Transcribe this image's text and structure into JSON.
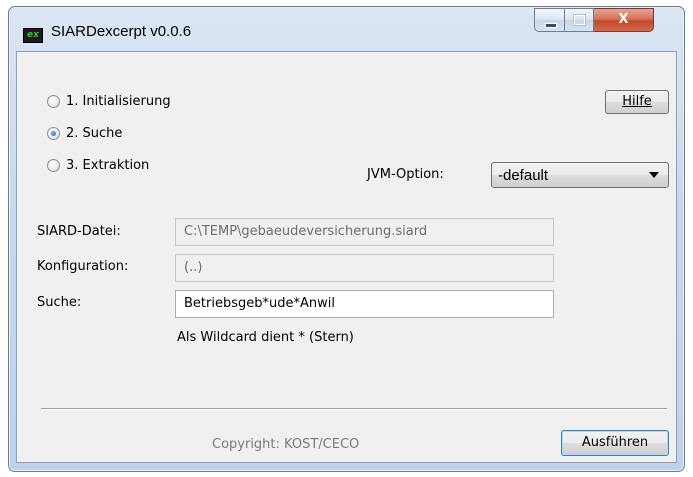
{
  "window": {
    "title": "SIARDexcerpt v0.0.6",
    "icon_text": "ex",
    "close_glyph": "X"
  },
  "modes": [
    {
      "label": "1. Initialisierung",
      "checked": false
    },
    {
      "label": "2. Suche",
      "checked": true
    },
    {
      "label": "3. Extraktion",
      "checked": false
    }
  ],
  "help_button": {
    "label": "Hilfe"
  },
  "jvm": {
    "label": "JVM-Option:",
    "value": "-default"
  },
  "fields": {
    "siard": {
      "label": "SIARD-Datei:",
      "value": "C:\\TEMP\\gebaeudeversicherung.siard"
    },
    "config": {
      "label": "Konfiguration:",
      "value": "(..)"
    },
    "search": {
      "label": "Suche:",
      "value": "Betriebsgeb*ude*Anwil"
    }
  },
  "hint": "Als Wildcard dient * (Stern)",
  "footer": {
    "copyright": "Copyright: KOST/CECO",
    "run_button": "Ausführen"
  },
  "colors": {
    "title_bar": "#c9d9ec",
    "client_bg": "#f0f0f0",
    "close_button": "#c3472c",
    "radio_selected": "#1b5fbf"
  }
}
